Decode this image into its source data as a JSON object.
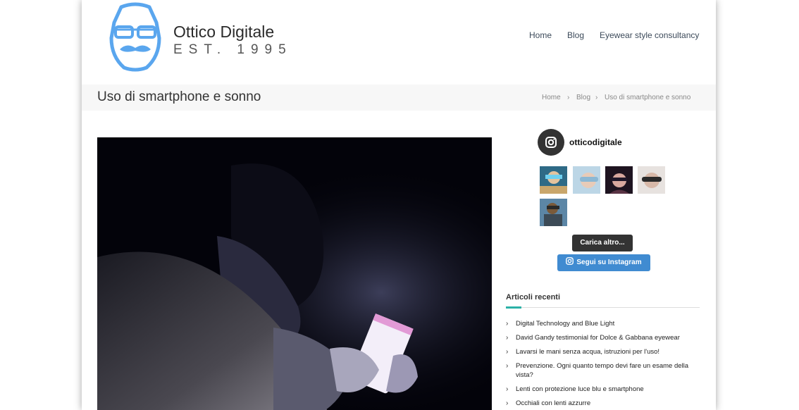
{
  "brand": {
    "name": "Ottico Digitale",
    "tagline": "EST. 1995"
  },
  "nav": {
    "items": [
      "Home",
      "Blog",
      "Eyewear style consultancy"
    ]
  },
  "page": {
    "title": "Uso di smartphone e sonno"
  },
  "breadcrumb": {
    "items": [
      "Home",
      "Blog",
      "Uso di smartphone e sonno"
    ],
    "separator": "›"
  },
  "instagram": {
    "username": "otticodigitale",
    "load_more": "Carica altro...",
    "follow": "Segui su Instagram"
  },
  "recent": {
    "heading": "Articoli recenti",
    "items": [
      "Digital Technology and Blue Light",
      "David Gandy testimonial for Dolce & Gabbana eyewear",
      "Lavarsi le mani senza acqua, istruzioni per l'uso!",
      "Prevenzione. Ogni quanto tempo devi fare un esame della vista?",
      "Lenti con protezione luce blu e smartphone",
      "Occhiali con lenti azzurre"
    ]
  },
  "colors": {
    "logo_blue": "#5aa6ee",
    "accent_teal": "#2bb1a7",
    "follow_blue": "#408bd1",
    "dark": "#333333"
  }
}
